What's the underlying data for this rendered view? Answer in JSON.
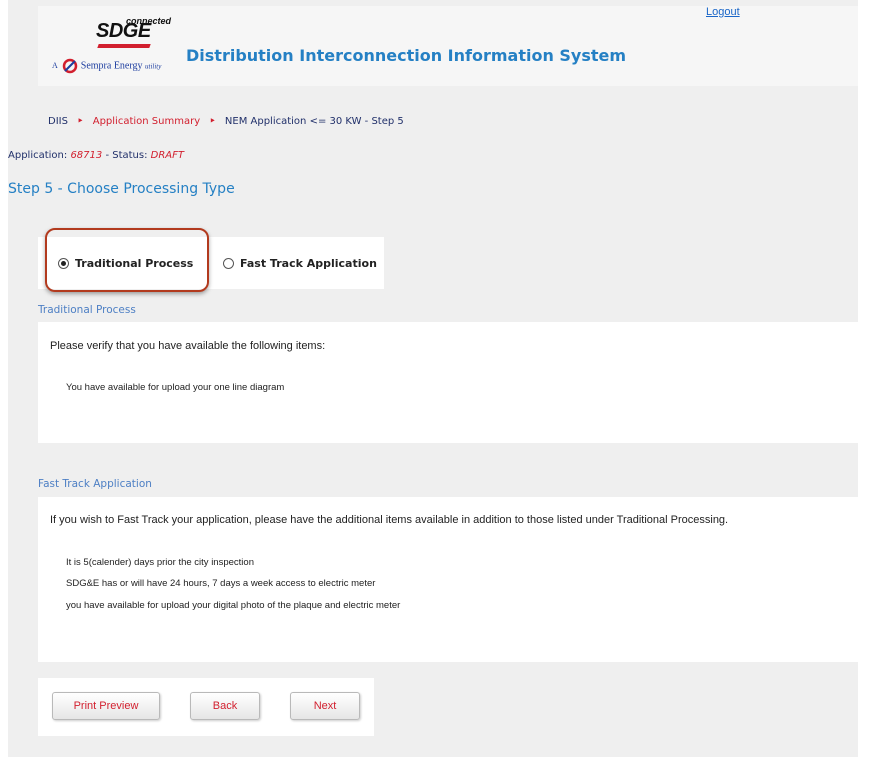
{
  "header": {
    "logo_brand": "SDGE",
    "logo_tagline": "connected",
    "logo_parent_prefix": "A",
    "logo_parent": "Sempra Energy",
    "logo_parent_suffix": "utility",
    "system_title": "Distribution Interconnection Information System",
    "logout_label": "Logout"
  },
  "breadcrumb": {
    "items": [
      "DIIS",
      "Application Summary",
      "NEM Application <= 30 KW - Step 5"
    ]
  },
  "application": {
    "label": "Application:",
    "id": "68713",
    "status_label": "- Status:",
    "status": "DRAFT"
  },
  "step_title": "Step 5 - Choose Processing Type",
  "processing_options": [
    {
      "label": "Traditional Process",
      "selected": true
    },
    {
      "label": "Fast Track Application",
      "selected": false
    }
  ],
  "traditional": {
    "section_title": "Traditional Process",
    "intro": "Please verify that you have available the following items:",
    "items": [
      "You have available for upload your one line diagram"
    ]
  },
  "fast_track": {
    "section_title": "Fast Track Application",
    "intro": "If you wish to Fast Track your application, please have the additional items available in addition to those listed under Traditional Processing.",
    "items": [
      "It is 5(calender) days prior the city inspection",
      "SDG&E has or will have 24 hours, 7 days a week access to electric meter",
      "you have available for upload your digital photo of the plaque and electric meter"
    ]
  },
  "buttons": {
    "print_preview": "Print Preview",
    "back": "Back",
    "next": "Next"
  },
  "colors": {
    "accent_blue": "#2580c4",
    "accent_red": "#d21f2e",
    "highlight_ring": "#b23a1e"
  }
}
